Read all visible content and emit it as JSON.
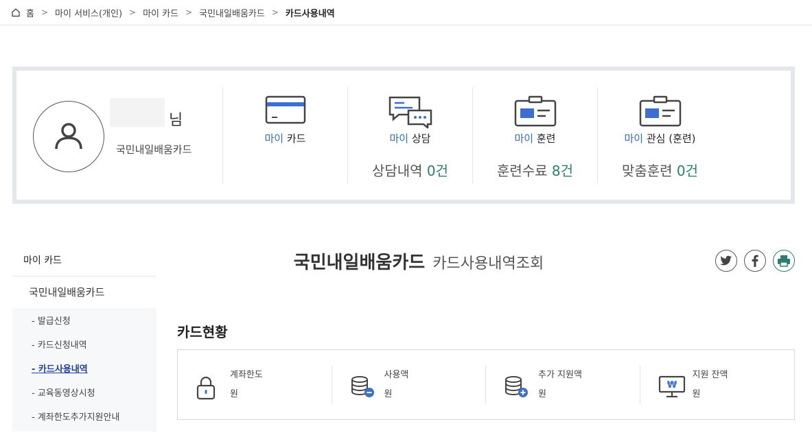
{
  "breadcrumb": [
    "홈",
    "마이 서비스(개인)",
    "마이 카드",
    "국민내일배움카드",
    "카드사용내역"
  ],
  "profile": {
    "suffix": "님",
    "card_name": "국민내일배움카드"
  },
  "stats": [
    {
      "accent": "마이",
      "rest": " 카드",
      "count_label": "",
      "count_num": ""
    },
    {
      "accent": "마이",
      "rest": " 상담",
      "count_label": "상담내역 ",
      "count_num": "0건"
    },
    {
      "accent": "마이",
      "rest": " 훈련",
      "count_label": "훈련수료 ",
      "count_num": "8건"
    },
    {
      "accent": "마이",
      "rest": " 관심 (훈련)",
      "count_label": "맞춤훈련 ",
      "count_num": "0건"
    }
  ],
  "sidebar": {
    "head": "마이 카드",
    "sub": "국민내일배움카드",
    "items": [
      "- 발급신청",
      "- 카드신청내역",
      "- 카드사용내역",
      "- 교육동영상시청",
      "- 계좌한도추가지원안내"
    ]
  },
  "heading": {
    "main": "국민내일배움카드",
    "sub": "카드사용내역조회"
  },
  "section": {
    "title": "카드현황"
  },
  "card_status": [
    {
      "label": "계좌한도",
      "unit": "원",
      "icon": "lock-icon"
    },
    {
      "label": "사용액",
      "unit": "원",
      "icon": "coins-minus-icon"
    },
    {
      "label": "추가 지원액",
      "unit": "원",
      "icon": "coins-plus-icon"
    },
    {
      "label": "지원 잔액",
      "unit": "원",
      "icon": "monitor-won-icon"
    }
  ],
  "colors": {
    "accent_blue": "#2f6fc9",
    "count_green": "#2a7f6f",
    "print_teal": "#2a7f6f",
    "border_gray": "#e4e7ec"
  }
}
